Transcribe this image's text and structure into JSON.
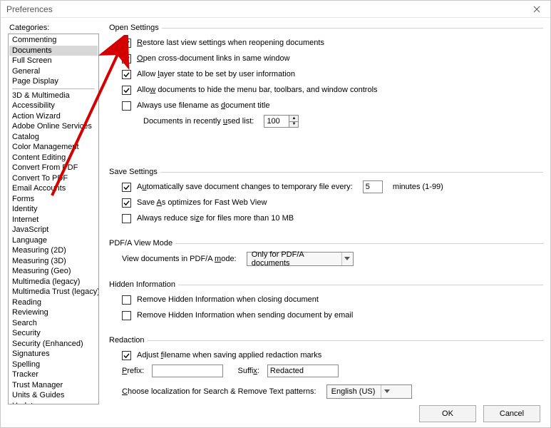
{
  "window": {
    "title": "Preferences"
  },
  "sidebar": {
    "label": "Categories:",
    "group1": [
      "Commenting",
      "Documents",
      "Full Screen",
      "General",
      "Page Display"
    ],
    "selected": "Documents",
    "group2": [
      "3D & Multimedia",
      "Accessibility",
      "Action Wizard",
      "Adobe Online Services",
      "Catalog",
      "Color Management",
      "Content Editing",
      "Convert From PDF",
      "Convert To PDF",
      "Email Accounts",
      "Forms",
      "Identity",
      "Internet",
      "JavaScript",
      "Language",
      "Measuring (2D)",
      "Measuring (3D)",
      "Measuring (Geo)",
      "Multimedia (legacy)",
      "Multimedia Trust (legacy)",
      "Reading",
      "Reviewing",
      "Search",
      "Security",
      "Security (Enhanced)",
      "Signatures",
      "Spelling",
      "Tracker",
      "Trust Manager",
      "Units & Guides",
      "Updater"
    ]
  },
  "openSettings": {
    "legend": "Open Settings",
    "restoreLast": {
      "checked": true,
      "pre": "",
      "u": "R",
      "post": "estore last view settings when reopening documents"
    },
    "crossDoc": {
      "checked": true,
      "pre": "",
      "u": "O",
      "post": "pen cross-document links in same window"
    },
    "layerState": {
      "checked": true,
      "pre": "Allow ",
      "u": "l",
      "post": "ayer state to be set by user information"
    },
    "hideMenu": {
      "checked": true,
      "pre": "Allo",
      "u": "w",
      "post": " documents to hide the menu bar, toolbars, and window controls"
    },
    "useFilename": {
      "checked": false,
      "pre": "Always use filename as ",
      "u": "d",
      "post": "ocument title"
    },
    "recentLabel": {
      "pre": "Documents in recently ",
      "u": "u",
      "post": "sed list:"
    },
    "recentValue": "100"
  },
  "saveSettings": {
    "legend": "Save Settings",
    "autoSave": {
      "checked": true,
      "pre": "A",
      "u": "u",
      "post": "tomatically save document changes to temporary file every:"
    },
    "autoSaveValue": "5",
    "autoSaveSuffix": "minutes (1-99)",
    "fastWeb": {
      "checked": true,
      "pre": "Save ",
      "u": "A",
      "post": "s optimizes for Fast Web View"
    },
    "reduceSize": {
      "checked": false,
      "pre": "Always reduce si",
      "u": "z",
      "post": "e for files more than 10 MB"
    }
  },
  "pdfa": {
    "legend": "PDF/A View Mode",
    "label": {
      "pre": "View documents in PDF/A ",
      "u": "m",
      "post": "ode:"
    },
    "value": "Only for PDF/A documents"
  },
  "hidden": {
    "legend": "Hidden Information",
    "closing": {
      "checked": false,
      "label": "Remove Hidden Information when closing document"
    },
    "emailing": {
      "checked": false,
      "label": "Remove Hidden Information when sending document by email"
    }
  },
  "redaction": {
    "legend": "Redaction",
    "adjust": {
      "checked": true,
      "pre": "Adjust ",
      "u": "f",
      "post": "ilename when saving applied redaction marks"
    },
    "prefixLabel": {
      "u": "P",
      "post": "refix:"
    },
    "prefixValue": "",
    "suffixLabel": {
      "pre": "Suffi",
      "u": "x",
      "post": ":"
    },
    "suffixValue": "Redacted",
    "localizeLabel": {
      "u": "C",
      "post": "hoose localization for Search & Remove Text patterns:"
    },
    "localizeValue": "English (US)"
  },
  "footer": {
    "ok": "OK",
    "cancel": "Cancel"
  }
}
